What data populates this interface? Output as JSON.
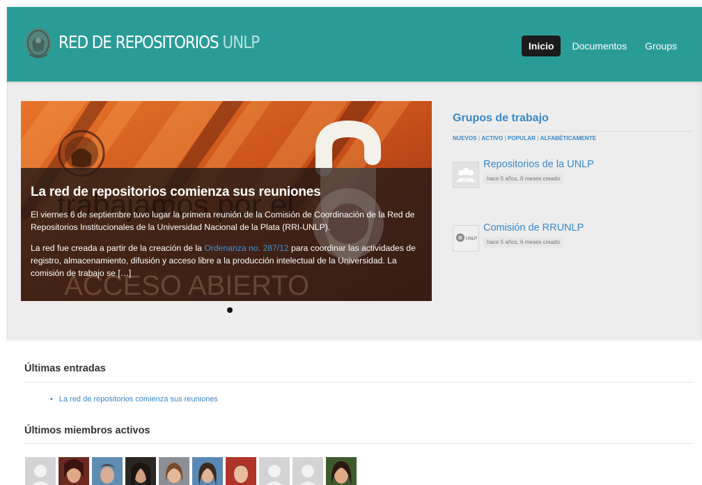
{
  "header": {
    "brand_main": "RED DE REPOSITORIOS",
    "brand_light": "UNLP",
    "nav": [
      {
        "label": "Inicio",
        "active": true
      },
      {
        "label": "Documentos",
        "active": false
      },
      {
        "label": "Groups",
        "active": false
      }
    ]
  },
  "slider": {
    "background_text_1": "trabajamos por el",
    "background_text_2": "ACCESO ABIERTO",
    "title": "La red de repositorios comienza sus reuniones",
    "paragraph_1": "El viernes 6 de septiembre tuvo lugar la primera reunión de la Comisión de Coordinación de la Red de Repositorios Institucionales de la Universidad Nacional de la Plata (RRI-UNLP).",
    "paragraph_2_before": "La red fue creada a partir de la creación de la ",
    "paragraph_2_link": "Ordenanza no. 287/12",
    "paragraph_2_after": "  para coordinar las actividades de registro, almacenamiento, difusión y acceso libre a la producción intelectual de  la Universidad. La comisión de trabajo se […]",
    "active_slide": 1,
    "slide_count": 1
  },
  "groups": {
    "title": "Grupos de trabajo",
    "filters": [
      "NUEVOS",
      "ACTIVO",
      "POPULAR",
      "ALFABÉTICAMENTE"
    ],
    "items": [
      {
        "name": "Repositorios de la UNLP",
        "meta": "hace 5 años, 6 meses creado",
        "avatar_text": ""
      },
      {
        "name": "Comisión de RRUNLP",
        "meta": "hace 5 años, 6 meses creado",
        "avatar_text": "UNLP"
      }
    ]
  },
  "latest_entries": {
    "title": "Últimas entradas",
    "items": [
      "La red de repositorios comienza sus reuniones"
    ]
  },
  "active_members": {
    "title": "Últimos miembros activos"
  },
  "colors": {
    "header_teal": "#2a9c98",
    "link_blue": "#3a87c8",
    "nav_active": "#1b1b1b"
  }
}
